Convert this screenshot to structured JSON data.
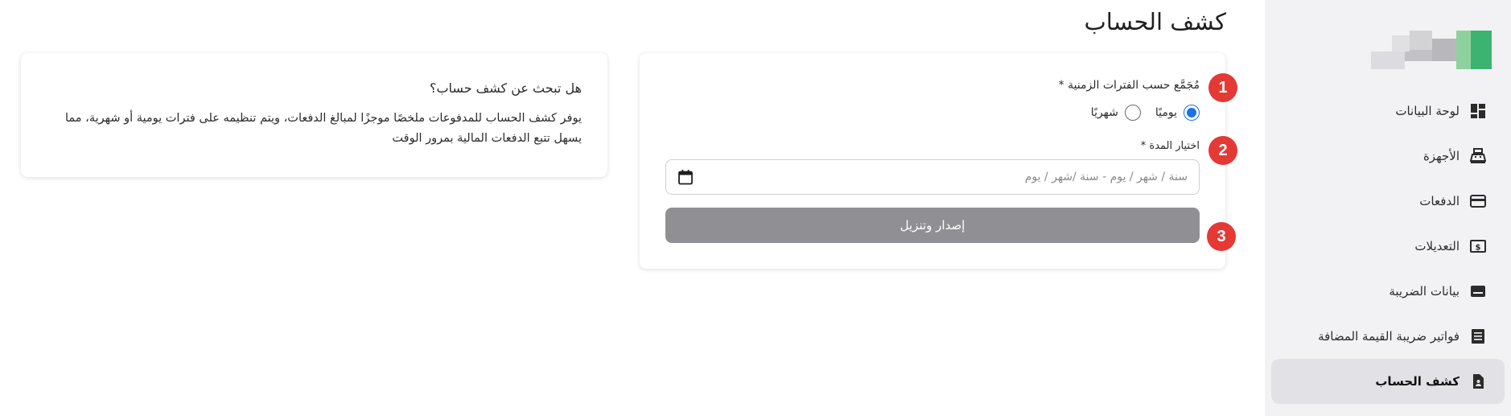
{
  "page": {
    "title": "كشف الحساب"
  },
  "sidebar": {
    "items": [
      {
        "label": "لوحة البيانات",
        "icon": "dashboard-icon"
      },
      {
        "label": "الأجهزة",
        "icon": "cash-register-icon"
      },
      {
        "label": "الدفعات",
        "icon": "credit-card-icon"
      },
      {
        "label": "التعديلات",
        "icon": "dollar-note-icon"
      },
      {
        "label": "بيانات الضريبة",
        "icon": "tax-card-icon"
      },
      {
        "label": "فواتير ضريبة القيمة المضافة",
        "icon": "receipt-icon"
      },
      {
        "label": "كشف الحساب",
        "icon": "statement-icon",
        "active": true
      }
    ]
  },
  "form": {
    "aggregate_label": "مُجَمَّع حسب الفترات الزمنية *",
    "daily_label": "يوميًا",
    "monthly_label": "شهريًا",
    "selected_period": "daily",
    "period_label": "اختيار المدة *",
    "date_placeholder": "سنة / شهر / يوم - سنة /شهر / يوم",
    "submit_label": "إصدار وتنزيل"
  },
  "steps": [
    "1",
    "2",
    "3"
  ],
  "info": {
    "title": "هل تبحث عن كشف حساب؟",
    "text": "يوفر كشف الحساب للمدفوعات ملخصًا موجزًا لمبالغ الدفعات، ويتم تنظيمه على فترات يومية أو شهرية، مما يسهل تتبع الدفعات المالية بمرور الوقت"
  },
  "colors": {
    "accent": "#1a73e8",
    "badge": "#e53935",
    "button": "#909094",
    "sidebar_bg": "#f2f2f5"
  }
}
